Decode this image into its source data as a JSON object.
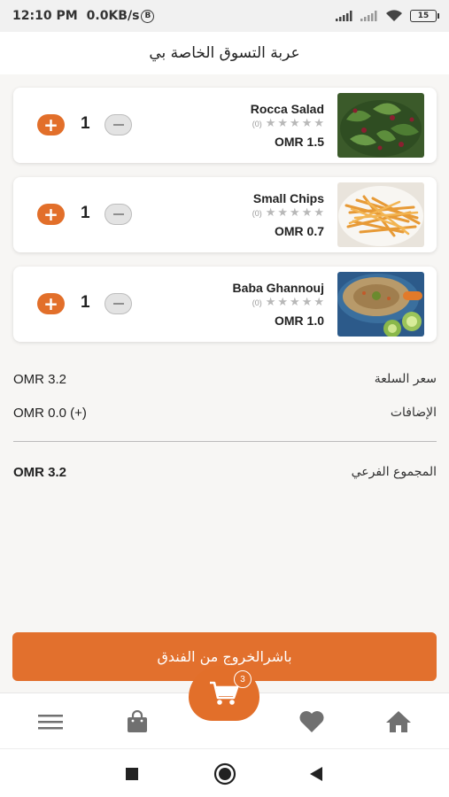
{
  "status_bar": {
    "time": "12:10 PM",
    "speed": "0.0KB/s",
    "b_badge": "B",
    "battery": "15"
  },
  "header": {
    "title": "عربة التسوق الخاصة بي"
  },
  "cart_items": [
    {
      "name": "Rocca Salad",
      "reviews": "(0)",
      "stars_filled": 0,
      "stars_total": 5,
      "price": "OMR 1.5",
      "quantity": "1",
      "image_icon": "salad-image"
    },
    {
      "name": "Small Chips",
      "reviews": "(0)",
      "stars_filled": 0,
      "stars_total": 5,
      "price": "OMR 0.7",
      "quantity": "1",
      "image_icon": "chips-image"
    },
    {
      "name": "Baba Ghannouj",
      "reviews": "(0)",
      "stars_filled": 0,
      "stars_total": 5,
      "price": "OMR 1.0",
      "quantity": "1",
      "image_icon": "baba-ghannouj-image"
    }
  ],
  "summary": {
    "item_price_label": "سعر السلعة",
    "item_price_value": "OMR 3.2",
    "addons_label": "الإضافات",
    "addons_value": "OMR 0.0 (+)",
    "subtotal_label": "المجموع الفرعي",
    "subtotal_value": "OMR 3.2"
  },
  "checkout": {
    "label": "باشرالخروج من الفندق"
  },
  "bottom_nav": {
    "cart_badge": "3",
    "icons": [
      "menu-icon",
      "shopping-bag-icon",
      "cart-icon",
      "heart-icon",
      "home-icon"
    ]
  },
  "colors": {
    "accent": "#e26f2a",
    "background": "#f7f6f4",
    "card": "#ffffff",
    "star_empty": "#b8b8b8"
  }
}
